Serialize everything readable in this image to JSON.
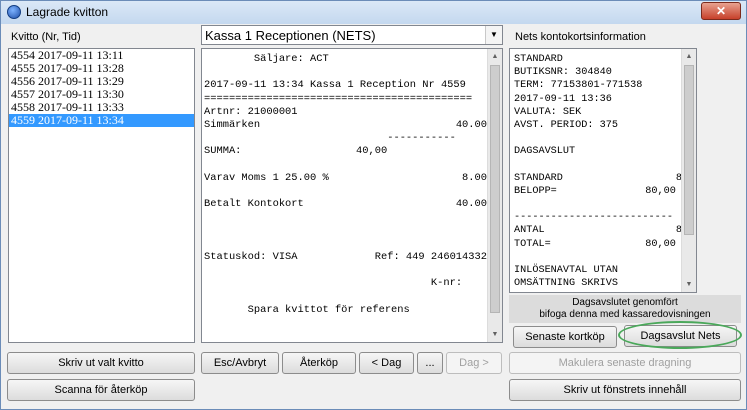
{
  "window": {
    "title": "Lagrade kvitton",
    "close_label": "✕"
  },
  "left": {
    "header": "Kvitto (Nr, Tid)",
    "items": [
      "4554 2017-09-11 13:11",
      "4555 2017-09-11 13:28",
      "4556 2017-09-11 13:29",
      "4557 2017-09-11 13:30",
      "4558 2017-09-11 13:33",
      "4559 2017-09-11 13:34"
    ],
    "selected_index": 5
  },
  "register": {
    "selected": "Kassa 1 Receptionen (NETS)"
  },
  "receipt": {
    "lines": [
      {
        "l": "        Säljare: ACT",
        "r": ""
      },
      {
        "l": "",
        "r": ""
      },
      {
        "l": "2017-09-11 13:34 Kassa 1 Reception Nr 4559",
        "r": ""
      },
      {
        "l": "===========================================",
        "r": ""
      },
      {
        "l": "Artnr: 21000001",
        "r": ""
      },
      {
        "l": "Simmärken",
        "r": "40.00"
      },
      {
        "l": "",
        "r": "-----------"
      },
      {
        "l": "SUMMA:",
        "r": "40,00"
      },
      {
        "l": "",
        "r": ""
      },
      {
        "l": "Varav Moms 1 25.00 %",
        "r": "8.00"
      },
      {
        "l": "",
        "r": ""
      },
      {
        "l": "Betalt Kontokort",
        "r": "40.00"
      },
      {
        "l": "",
        "r": ""
      },
      {
        "l": "",
        "r": ""
      },
      {
        "l": "",
        "r": ""
      },
      {
        "l": "Statuskod: VISA",
        "r": "Ref: 449 246014332"
      },
      {
        "l": "",
        "r": ""
      },
      {
        "l": "",
        "r": "K-nr:    "
      },
      {
        "l": "",
        "r": ""
      },
      {
        "l": "       Spara kvittot för referens",
        "r": ""
      }
    ]
  },
  "nets": {
    "header": "Nets kontokortsinformation",
    "lines": [
      {
        "l": "STANDARD",
        "r": ""
      },
      {
        "l": "BUTIKSNR: 304840",
        "r": ""
      },
      {
        "l": "TERM: 77153801-771538",
        "r": ""
      },
      {
        "l": "2017-09-11 13:36",
        "r": ""
      },
      {
        "l": "VALUTA: SEK",
        "r": ""
      },
      {
        "l": "AVST. PERIOD: 375",
        "r": ""
      },
      {
        "l": "",
        "r": ""
      },
      {
        "l": "DAGSAVSLUT",
        "r": ""
      },
      {
        "l": "",
        "r": ""
      },
      {
        "l": "STANDARD",
        "r": "8"
      },
      {
        "l": "BELOPP=",
        "r": "80,00"
      },
      {
        "l": "",
        "r": ""
      },
      {
        "l": "--------------------------",
        "r": ""
      },
      {
        "l": "ANTAL",
        "r": "8"
      },
      {
        "l": "TOTAL=",
        "r": "80,00"
      },
      {
        "l": "",
        "r": ""
      },
      {
        "l": "INLÖSENAVTAL UTAN",
        "r": ""
      },
      {
        "l": "OMSÄTTNING SKRIVS",
        "r": ""
      }
    ],
    "info_line1": "Dagsavslutet genomfört",
    "info_line2": "bifoga denna med kassaredovisningen"
  },
  "buttons": {
    "print_selected": "Skriv ut valt kvitto",
    "scan_return": "Scanna för återköp",
    "esc": "Esc/Avbryt",
    "return": "Återköp",
    "prev_day": "< Dag",
    "ellipsis": "...",
    "next_day": "Dag >",
    "void_last": "Makulera senaste dragning",
    "latest_card": "Senaste kortköp",
    "day_close": "Dagsavslut Nets",
    "print_window": "Skriv ut fönstrets innehåll"
  }
}
